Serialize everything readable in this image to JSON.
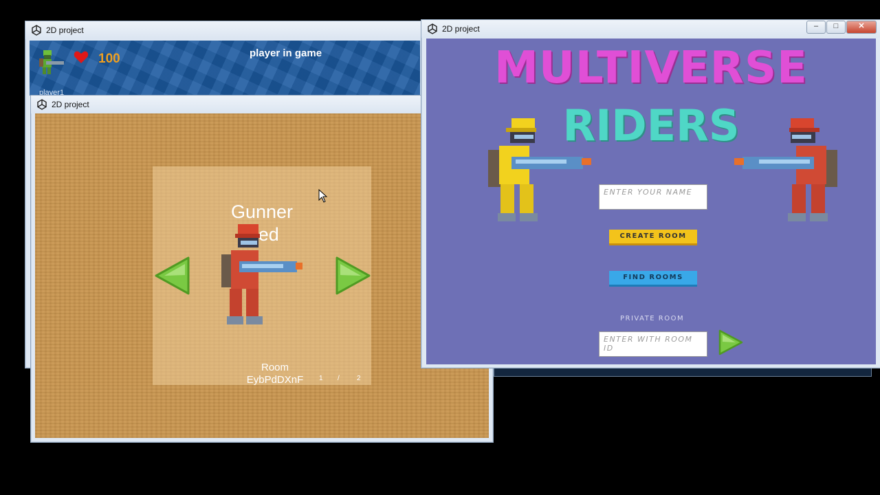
{
  "windows": {
    "back": {
      "title": "2D project",
      "hud": {
        "health": "100",
        "status": "player in game",
        "player_name": "player1"
      }
    },
    "select": {
      "title": "2D project",
      "character_name_line1": "Gunner",
      "character_name_line2": "Red",
      "room_label": "Room",
      "room_id": "EybPdDXnF",
      "page_current": "1",
      "page_sep": "/",
      "page_total": "2"
    },
    "menu": {
      "title": "2D project",
      "logo_line1": "MULTIVERSE",
      "logo_line2": "RIDERS",
      "name_placeholder": "ENTER YOUR NAME",
      "create_room": "CREATE ROOM",
      "find_rooms": "FIND ROOMS",
      "private_room_label": "PRIVATE ROOM",
      "room_id_placeholder": "ENTER WITH ROOM ID"
    }
  },
  "colors": {
    "arrow_green": "#7ac943",
    "create_yellow": "#f3c31b",
    "find_blue": "#39a8e8",
    "menu_bg": "#6e70b6"
  }
}
